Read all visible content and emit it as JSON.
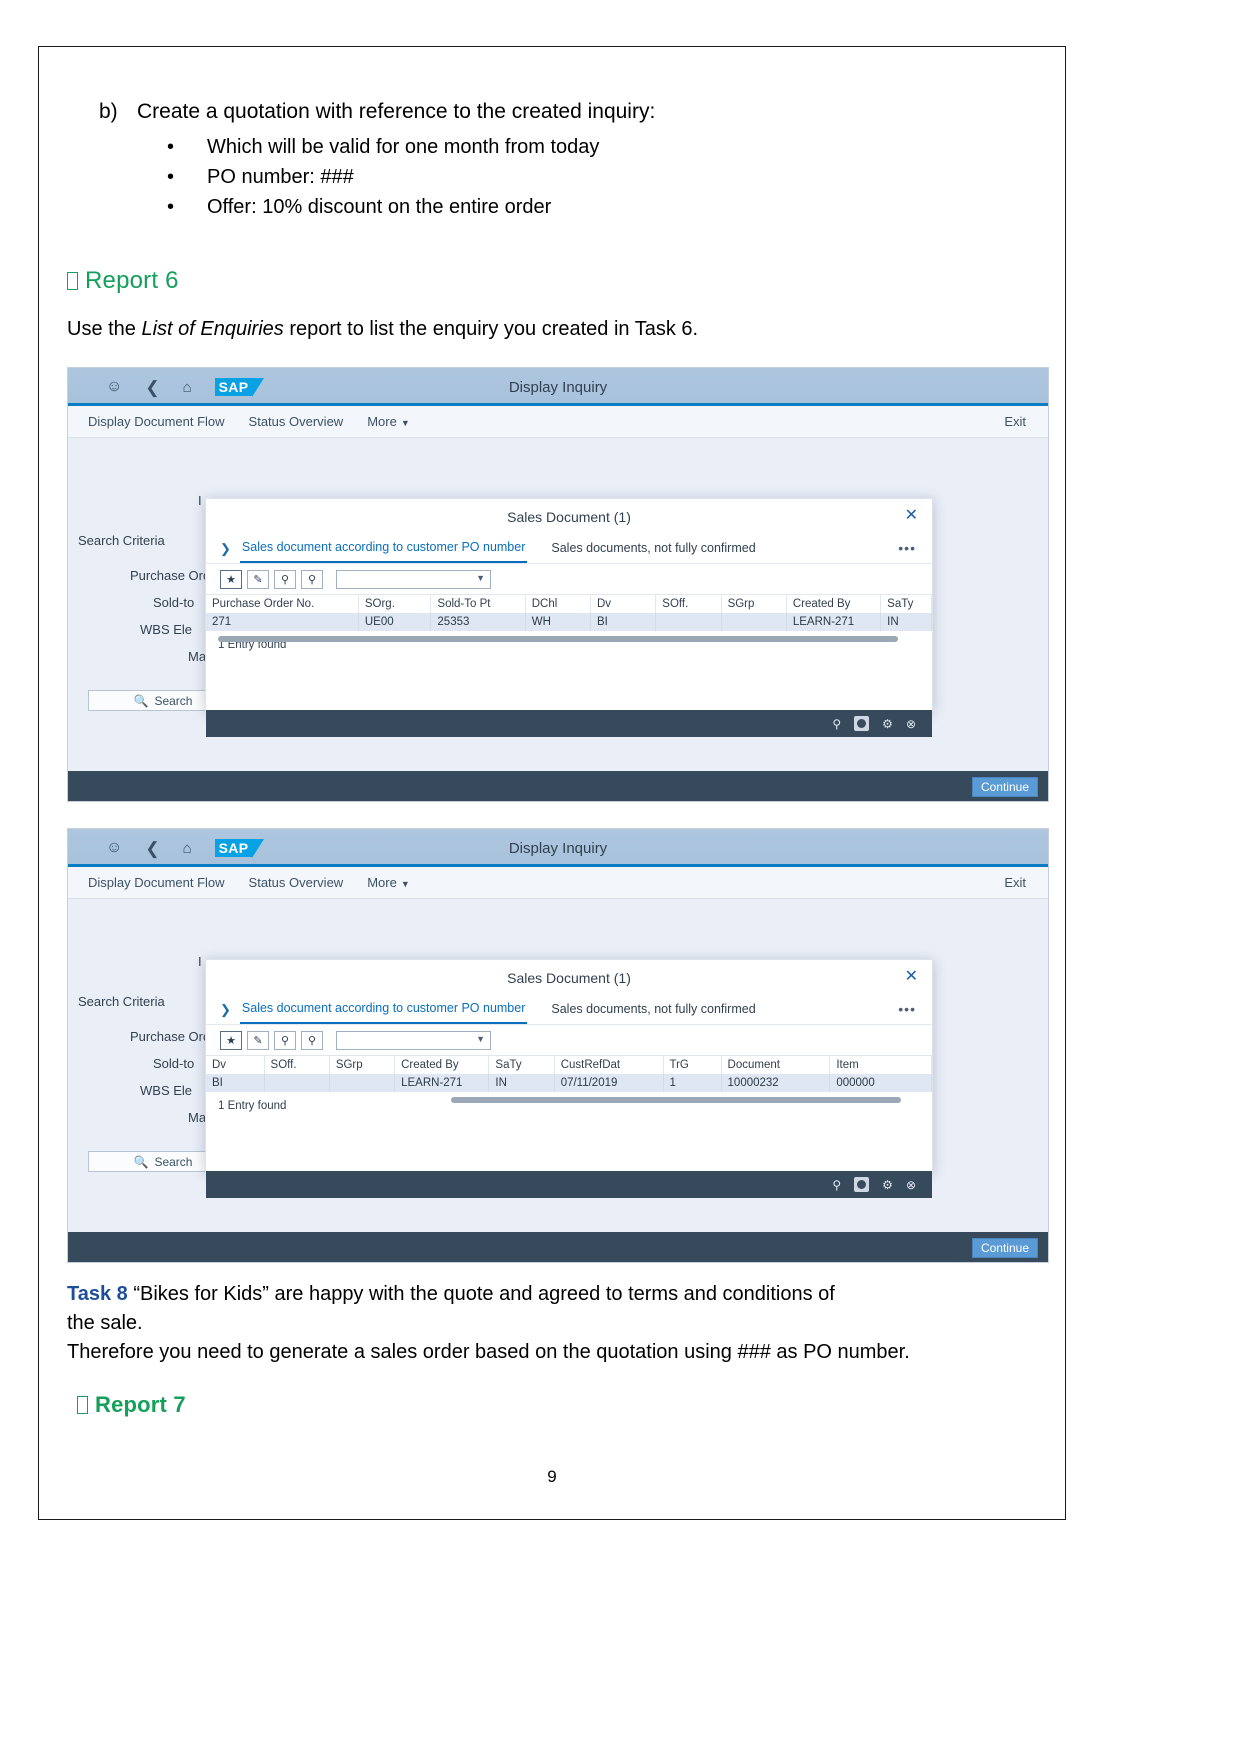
{
  "document": {
    "task_b": {
      "marker": "b)",
      "text": "Create a quotation with reference to the created inquiry:",
      "bullets": [
        "Which will be valid for one month from today",
        "PO number: ###",
        "Offer: 10% discount on the entire order"
      ]
    },
    "report6_heading": "Report 6",
    "report7_heading": "Report 7",
    "intro_before": "Use the ",
    "intro_italic": "List of Enquiries",
    "intro_after": " report to list the enquiry you created in Task 6.",
    "task8": {
      "label": "Task 8",
      "line1": " “Bikes for Kids” are happy with the quote and agreed to terms and conditions of",
      "line2": "the sale.",
      "line3": "Therefore you need to generate a sales order based on the quotation using ### as PO number."
    },
    "page_number": "9"
  },
  "sap": {
    "header": {
      "title": "Display Inquiry",
      "logo": "SAP",
      "icons": [
        "user-icon",
        "back-icon",
        "home-icon"
      ]
    },
    "toolbar": {
      "items": [
        "Display Document Flow",
        "Status Overview",
        "More"
      ],
      "exit": "Exit"
    },
    "criteria": {
      "title": "Search Criteria",
      "inquiry": "I",
      "labels": [
        "Purchase Orde",
        "Sold-to",
        "WBS Ele",
        "Ma"
      ],
      "search_button": "Search"
    },
    "continue_button": "Continue",
    "dialog": {
      "title": "Sales Document (1)",
      "tabs": [
        "Sales document according to customer PO number",
        "Sales documents, not fully confirmed"
      ],
      "overflow": "•••",
      "filter_buttons": [
        "favorite-icon",
        "personalize-icon",
        "search-icon",
        "search-plus-icon"
      ],
      "combo_value": "",
      "entry_found": "1 Entry found"
    },
    "screenshot1": {
      "columns": [
        "Purchase Order No.",
        "SOrg.",
        "Sold-To Pt",
        "DChl",
        "Dv",
        "SOff.",
        "SGrp",
        "Created By",
        "SaTy"
      ],
      "rows": [
        [
          "271",
          "UE00",
          "25353",
          "WH",
          "BI",
          "",
          "",
          "LEARN-271",
          "IN"
        ]
      ]
    },
    "screenshot2": {
      "columns": [
        "Dv",
        "SOff.",
        "SGrp",
        "Created By",
        "SaTy",
        "CustRefDat",
        "TrG",
        "Document",
        "Item"
      ],
      "rows": [
        [
          "BI",
          "",
          "",
          "LEARN-271",
          "IN",
          "07/11/2019",
          "1",
          "10000232",
          "000000"
        ]
      ]
    }
  },
  "colors": {
    "green": "#14a05a",
    "blue": "#1f4e9c",
    "sap_blue": "#08a1e3",
    "accent": "#0a6ebd"
  }
}
